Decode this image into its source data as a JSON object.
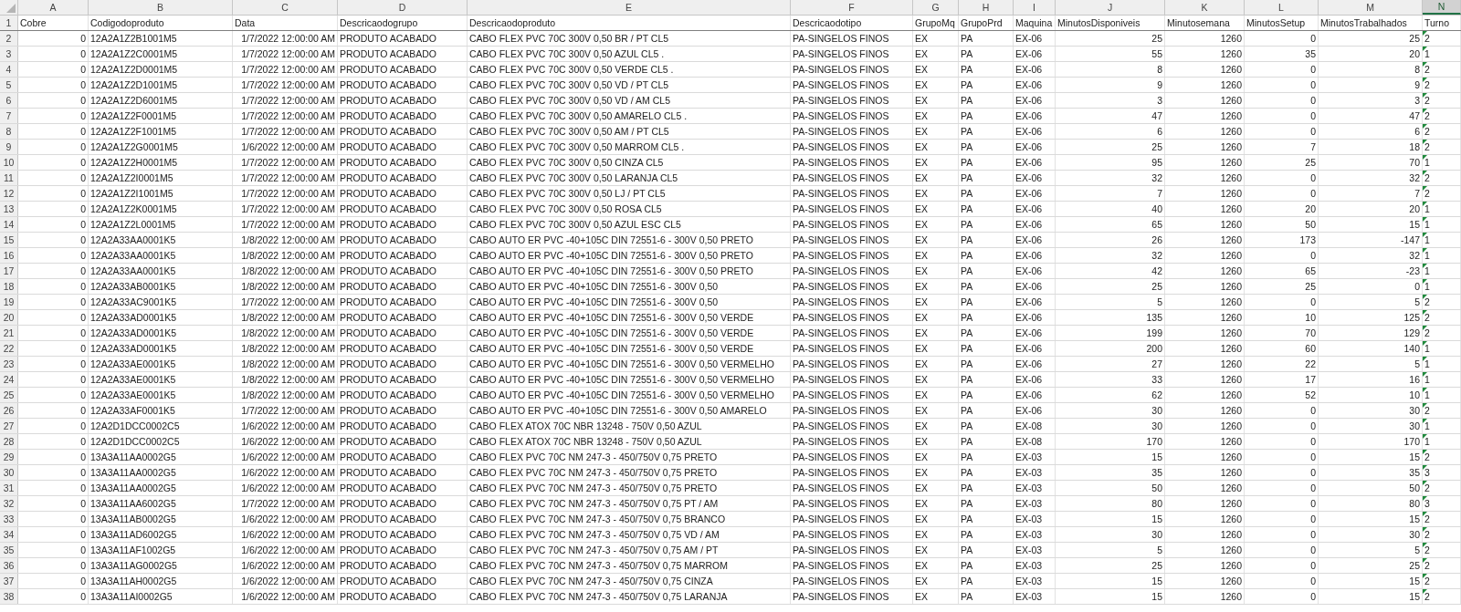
{
  "sheet": {
    "columns": [
      {
        "letter": "A",
        "kind": "number",
        "selected": false
      },
      {
        "letter": "B",
        "kind": "text",
        "selected": false
      },
      {
        "letter": "C",
        "kind": "number",
        "selected": false
      },
      {
        "letter": "D",
        "kind": "text",
        "selected": false
      },
      {
        "letter": "E",
        "kind": "text",
        "selected": false
      },
      {
        "letter": "F",
        "kind": "text",
        "selected": false
      },
      {
        "letter": "G",
        "kind": "text",
        "selected": false
      },
      {
        "letter": "H",
        "kind": "text",
        "selected": false
      },
      {
        "letter": "I",
        "kind": "text",
        "selected": false
      },
      {
        "letter": "J",
        "kind": "number",
        "selected": false
      },
      {
        "letter": "K",
        "kind": "number",
        "selected": false
      },
      {
        "letter": "L",
        "kind": "number",
        "selected": false
      },
      {
        "letter": "M",
        "kind": "number",
        "selected": false
      },
      {
        "letter": "N",
        "kind": "text",
        "selected": true
      }
    ],
    "rows": [
      {
        "number": "1",
        "kind": "header",
        "warning": false,
        "cells": [
          "Cobre",
          "Codigodoproduto",
          "Data",
          "Descricaodogrupo",
          "Descricaodoproduto",
          "Descricaodotipo",
          "GrupoMq",
          "GrupoPrd",
          "Maquina",
          "MinutosDisponiveis",
          "Minutosemana",
          "MinutosSetup",
          "MinutosTrabalhados",
          "Turno"
        ]
      },
      {
        "number": "2",
        "kind": "data",
        "warning": true,
        "cells": [
          "0",
          "12A2A1Z2B1001M5",
          "1/7/2022 12:00:00 AM",
          "PRODUTO ACABADO",
          "CABO FLEX PVC 70C 300V 0,50 BR / PT CL5",
          "PA-SINGELOS FINOS",
          "EX",
          "PA",
          "EX-06",
          "25",
          "1260",
          "0",
          "25",
          "2"
        ]
      },
      {
        "number": "3",
        "kind": "data",
        "warning": true,
        "cells": [
          "0",
          "12A2A1Z2C0001M5",
          "1/7/2022 12:00:00 AM",
          "PRODUTO ACABADO",
          "CABO FLEX PVC 70C 300V 0,50 AZUL CL5 .",
          "PA-SINGELOS FINOS",
          "EX",
          "PA",
          "EX-06",
          "55",
          "1260",
          "35",
          "20",
          "1"
        ]
      },
      {
        "number": "4",
        "kind": "data",
        "warning": true,
        "cells": [
          "0",
          "12A2A1Z2D0001M5",
          "1/7/2022 12:00:00 AM",
          "PRODUTO ACABADO",
          "CABO FLEX PVC 70C 300V 0,50 VERDE CL5 .",
          "PA-SINGELOS FINOS",
          "EX",
          "PA",
          "EX-06",
          "8",
          "1260",
          "0",
          "8",
          "2"
        ]
      },
      {
        "number": "5",
        "kind": "data",
        "warning": true,
        "cells": [
          "0",
          "12A2A1Z2D1001M5",
          "1/7/2022 12:00:00 AM",
          "PRODUTO ACABADO",
          "CABO FLEX PVC 70C 300V 0,50 VD / PT CL5",
          "PA-SINGELOS FINOS",
          "EX",
          "PA",
          "EX-06",
          "9",
          "1260",
          "0",
          "9",
          "2"
        ]
      },
      {
        "number": "6",
        "kind": "data",
        "warning": true,
        "cells": [
          "0",
          "12A2A1Z2D6001M5",
          "1/7/2022 12:00:00 AM",
          "PRODUTO ACABADO",
          "CABO FLEX PVC 70C 300V 0,50 VD / AM CL5",
          "PA-SINGELOS FINOS",
          "EX",
          "PA",
          "EX-06",
          "3",
          "1260",
          "0",
          "3",
          "2"
        ]
      },
      {
        "number": "7",
        "kind": "data",
        "warning": true,
        "cells": [
          "0",
          "12A2A1Z2F0001M5",
          "1/7/2022 12:00:00 AM",
          "PRODUTO ACABADO",
          "CABO FLEX PVC 70C 300V 0,50 AMARELO CL5 .",
          "PA-SINGELOS FINOS",
          "EX",
          "PA",
          "EX-06",
          "47",
          "1260",
          "0",
          "47",
          "2"
        ]
      },
      {
        "number": "8",
        "kind": "data",
        "warning": true,
        "cells": [
          "0",
          "12A2A1Z2F1001M5",
          "1/7/2022 12:00:00 AM",
          "PRODUTO ACABADO",
          "CABO FLEX PVC 70C 300V 0,50 AM / PT CL5",
          "PA-SINGELOS FINOS",
          "EX",
          "PA",
          "EX-06",
          "6",
          "1260",
          "0",
          "6",
          "2"
        ]
      },
      {
        "number": "9",
        "kind": "data",
        "warning": true,
        "cells": [
          "0",
          "12A2A1Z2G0001M5",
          "1/6/2022 12:00:00 AM",
          "PRODUTO ACABADO",
          "CABO FLEX PVC 70C 300V 0,50 MARROM CL5 .",
          "PA-SINGELOS FINOS",
          "EX",
          "PA",
          "EX-06",
          "25",
          "1260",
          "7",
          "18",
          "2"
        ]
      },
      {
        "number": "10",
        "kind": "data",
        "warning": true,
        "cells": [
          "0",
          "12A2A1Z2H0001M5",
          "1/7/2022 12:00:00 AM",
          "PRODUTO ACABADO",
          "CABO FLEX PVC 70C 300V 0,50 CINZA CL5",
          "PA-SINGELOS FINOS",
          "EX",
          "PA",
          "EX-06",
          "95",
          "1260",
          "25",
          "70",
          "1"
        ]
      },
      {
        "number": "11",
        "kind": "data",
        "warning": true,
        "cells": [
          "0",
          "12A2A1Z2I0001M5",
          "1/7/2022 12:00:00 AM",
          "PRODUTO ACABADO",
          "CABO FLEX PVC 70C 300V 0,50 LARANJA CL5",
          "PA-SINGELOS FINOS",
          "EX",
          "PA",
          "EX-06",
          "32",
          "1260",
          "0",
          "32",
          "2"
        ]
      },
      {
        "number": "12",
        "kind": "data",
        "warning": true,
        "cells": [
          "0",
          "12A2A1Z2I1001M5",
          "1/7/2022 12:00:00 AM",
          "PRODUTO ACABADO",
          "CABO FLEX PVC 70C 300V 0,50 LJ / PT CL5",
          "PA-SINGELOS FINOS",
          "EX",
          "PA",
          "EX-06",
          "7",
          "1260",
          "0",
          "7",
          "2"
        ]
      },
      {
        "number": "13",
        "kind": "data",
        "warning": true,
        "cells": [
          "0",
          "12A2A1Z2K0001M5",
          "1/7/2022 12:00:00 AM",
          "PRODUTO ACABADO",
          "CABO FLEX PVC 70C 300V 0,50 ROSA CL5",
          "PA-SINGELOS FINOS",
          "EX",
          "PA",
          "EX-06",
          "40",
          "1260",
          "20",
          "20",
          "1"
        ]
      },
      {
        "number": "14",
        "kind": "data",
        "warning": true,
        "cells": [
          "0",
          "12A2A1Z2L0001M5",
          "1/7/2022 12:00:00 AM",
          "PRODUTO ACABADO",
          "CABO FLEX PVC 70C 300V 0,50 AZUL ESC CL5",
          "PA-SINGELOS FINOS",
          "EX",
          "PA",
          "EX-06",
          "65",
          "1260",
          "50",
          "15",
          "1"
        ]
      },
      {
        "number": "15",
        "kind": "data",
        "warning": true,
        "cells": [
          "0",
          "12A2A33AA0001K5",
          "1/8/2022 12:00:00 AM",
          "PRODUTO ACABADO",
          "CABO AUTO ER PVC -40+105C DIN 72551-6 - 300V 0,50 PRETO",
          "PA-SINGELOS FINOS",
          "EX",
          "PA",
          "EX-06",
          "26",
          "1260",
          "173",
          "-147",
          "1"
        ]
      },
      {
        "number": "16",
        "kind": "data",
        "warning": true,
        "cells": [
          "0",
          "12A2A33AA0001K5",
          "1/8/2022 12:00:00 AM",
          "PRODUTO ACABADO",
          "CABO AUTO ER PVC -40+105C DIN 72551-6 - 300V 0,50 PRETO",
          "PA-SINGELOS FINOS",
          "EX",
          "PA",
          "EX-06",
          "32",
          "1260",
          "0",
          "32",
          "1"
        ]
      },
      {
        "number": "17",
        "kind": "data",
        "warning": true,
        "cells": [
          "0",
          "12A2A33AA0001K5",
          "1/8/2022 12:00:00 AM",
          "PRODUTO ACABADO",
          "CABO AUTO ER PVC -40+105C DIN 72551-6 - 300V 0,50 PRETO",
          "PA-SINGELOS FINOS",
          "EX",
          "PA",
          "EX-06",
          "42",
          "1260",
          "65",
          "-23",
          "1"
        ]
      },
      {
        "number": "18",
        "kind": "data",
        "warning": true,
        "cells": [
          "0",
          "12A2A33AB0001K5",
          "1/8/2022 12:00:00 AM",
          "PRODUTO ACABADO",
          "CABO AUTO ER PVC -40+105C DIN 72551-6 - 300V 0,50",
          "PA-SINGELOS FINOS",
          "EX",
          "PA",
          "EX-06",
          "25",
          "1260",
          "25",
          "0",
          "1"
        ]
      },
      {
        "number": "19",
        "kind": "data",
        "warning": true,
        "cells": [
          "0",
          "12A2A33AC9001K5",
          "1/7/2022 12:00:00 AM",
          "PRODUTO ACABADO",
          "CABO AUTO ER PVC -40+105C DIN 72551-6 - 300V 0,50",
          "PA-SINGELOS FINOS",
          "EX",
          "PA",
          "EX-06",
          "5",
          "1260",
          "0",
          "5",
          "2"
        ]
      },
      {
        "number": "20",
        "kind": "data",
        "warning": true,
        "cells": [
          "0",
          "12A2A33AD0001K5",
          "1/8/2022 12:00:00 AM",
          "PRODUTO ACABADO",
          "CABO AUTO ER PVC -40+105C DIN 72551-6 - 300V 0,50 VERDE",
          "PA-SINGELOS FINOS",
          "EX",
          "PA",
          "EX-06",
          "135",
          "1260",
          "10",
          "125",
          "2"
        ]
      },
      {
        "number": "21",
        "kind": "data",
        "warning": true,
        "cells": [
          "0",
          "12A2A33AD0001K5",
          "1/8/2022 12:00:00 AM",
          "PRODUTO ACABADO",
          "CABO AUTO ER PVC -40+105C DIN 72551-6 - 300V 0,50 VERDE",
          "PA-SINGELOS FINOS",
          "EX",
          "PA",
          "EX-06",
          "199",
          "1260",
          "70",
          "129",
          "2"
        ]
      },
      {
        "number": "22",
        "kind": "data",
        "warning": true,
        "cells": [
          "0",
          "12A2A33AD0001K5",
          "1/8/2022 12:00:00 AM",
          "PRODUTO ACABADO",
          "CABO AUTO ER PVC -40+105C DIN 72551-6 - 300V 0,50 VERDE",
          "PA-SINGELOS FINOS",
          "EX",
          "PA",
          "EX-06",
          "200",
          "1260",
          "60",
          "140",
          "1"
        ]
      },
      {
        "number": "23",
        "kind": "data",
        "warning": true,
        "cells": [
          "0",
          "12A2A33AE0001K5",
          "1/8/2022 12:00:00 AM",
          "PRODUTO ACABADO",
          "CABO AUTO ER PVC -40+105C DIN 72551-6 - 300V 0,50 VERMELHO",
          "PA-SINGELOS FINOS",
          "EX",
          "PA",
          "EX-06",
          "27",
          "1260",
          "22",
          "5",
          "1"
        ]
      },
      {
        "number": "24",
        "kind": "data",
        "warning": true,
        "cells": [
          "0",
          "12A2A33AE0001K5",
          "1/8/2022 12:00:00 AM",
          "PRODUTO ACABADO",
          "CABO AUTO ER PVC -40+105C DIN 72551-6 - 300V 0,50 VERMELHO",
          "PA-SINGELOS FINOS",
          "EX",
          "PA",
          "EX-06",
          "33",
          "1260",
          "17",
          "16",
          "1"
        ]
      },
      {
        "number": "25",
        "kind": "data",
        "warning": true,
        "cells": [
          "0",
          "12A2A33AE0001K5",
          "1/8/2022 12:00:00 AM",
          "PRODUTO ACABADO",
          "CABO AUTO ER PVC -40+105C DIN 72551-6 - 300V 0,50 VERMELHO",
          "PA-SINGELOS FINOS",
          "EX",
          "PA",
          "EX-06",
          "62",
          "1260",
          "52",
          "10",
          "1"
        ]
      },
      {
        "number": "26",
        "kind": "data",
        "warning": true,
        "cells": [
          "0",
          "12A2A33AF0001K5",
          "1/7/2022 12:00:00 AM",
          "PRODUTO ACABADO",
          "CABO AUTO ER PVC -40+105C DIN 72551-6 - 300V 0,50 AMARELO",
          "PA-SINGELOS FINOS",
          "EX",
          "PA",
          "EX-06",
          "30",
          "1260",
          "0",
          "30",
          "2"
        ]
      },
      {
        "number": "27",
        "kind": "data",
        "warning": true,
        "cells": [
          "0",
          "12A2D1DCC0002C5",
          "1/6/2022 12:00:00 AM",
          "PRODUTO ACABADO",
          "CABO FLEX ATOX 70C NBR 13248 - 750V 0,50 AZUL",
          "PA-SINGELOS FINOS",
          "EX",
          "PA",
          "EX-08",
          "30",
          "1260",
          "0",
          "30",
          "1"
        ]
      },
      {
        "number": "28",
        "kind": "data",
        "warning": true,
        "cells": [
          "0",
          "12A2D1DCC0002C5",
          "1/6/2022 12:00:00 AM",
          "PRODUTO ACABADO",
          "CABO FLEX ATOX 70C NBR 13248 - 750V 0,50 AZUL",
          "PA-SINGELOS FINOS",
          "EX",
          "PA",
          "EX-08",
          "170",
          "1260",
          "0",
          "170",
          "1"
        ]
      },
      {
        "number": "29",
        "kind": "data",
        "warning": true,
        "cells": [
          "0",
          "13A3A11AA0002G5",
          "1/6/2022 12:00:00 AM",
          "PRODUTO ACABADO",
          "CABO FLEX PVC 70C NM 247-3 - 450/750V 0,75 PRETO",
          "PA-SINGELOS FINOS",
          "EX",
          "PA",
          "EX-03",
          "15",
          "1260",
          "0",
          "15",
          "2"
        ]
      },
      {
        "number": "30",
        "kind": "data",
        "warning": true,
        "cells": [
          "0",
          "13A3A11AA0002G5",
          "1/6/2022 12:00:00 AM",
          "PRODUTO ACABADO",
          "CABO FLEX PVC 70C NM 247-3 - 450/750V 0,75 PRETO",
          "PA-SINGELOS FINOS",
          "EX",
          "PA",
          "EX-03",
          "35",
          "1260",
          "0",
          "35",
          "3"
        ]
      },
      {
        "number": "31",
        "kind": "data",
        "warning": true,
        "cells": [
          "0",
          "13A3A11AA0002G5",
          "1/6/2022 12:00:00 AM",
          "PRODUTO ACABADO",
          "CABO FLEX PVC 70C NM 247-3 - 450/750V 0,75 PRETO",
          "PA-SINGELOS FINOS",
          "EX",
          "PA",
          "EX-03",
          "50",
          "1260",
          "0",
          "50",
          "2"
        ]
      },
      {
        "number": "32",
        "kind": "data",
        "warning": true,
        "cells": [
          "0",
          "13A3A11AA6002G5",
          "1/7/2022 12:00:00 AM",
          "PRODUTO ACABADO",
          "CABO FLEX PVC 70C NM 247-3 - 450/750V 0,75 PT / AM",
          "PA-SINGELOS FINOS",
          "EX",
          "PA",
          "EX-03",
          "80",
          "1260",
          "0",
          "80",
          "3"
        ]
      },
      {
        "number": "33",
        "kind": "data",
        "warning": true,
        "cells": [
          "0",
          "13A3A11AB0002G5",
          "1/6/2022 12:00:00 AM",
          "PRODUTO ACABADO",
          "CABO FLEX PVC 70C NM 247-3 - 450/750V 0,75 BRANCO",
          "PA-SINGELOS FINOS",
          "EX",
          "PA",
          "EX-03",
          "15",
          "1260",
          "0",
          "15",
          "2"
        ]
      },
      {
        "number": "34",
        "kind": "data",
        "warning": true,
        "cells": [
          "0",
          "13A3A11AD6002G5",
          "1/6/2022 12:00:00 AM",
          "PRODUTO ACABADO",
          "CABO FLEX PVC 70C NM 247-3 - 450/750V 0,75 VD / AM",
          "PA-SINGELOS FINOS",
          "EX",
          "PA",
          "EX-03",
          "30",
          "1260",
          "0",
          "30",
          "2"
        ]
      },
      {
        "number": "35",
        "kind": "data",
        "warning": true,
        "cells": [
          "0",
          "13A3A11AF1002G5",
          "1/6/2022 12:00:00 AM",
          "PRODUTO ACABADO",
          "CABO FLEX PVC 70C NM 247-3 - 450/750V 0,75 AM / PT",
          "PA-SINGELOS FINOS",
          "EX",
          "PA",
          "EX-03",
          "5",
          "1260",
          "0",
          "5",
          "2"
        ]
      },
      {
        "number": "36",
        "kind": "data",
        "warning": true,
        "cells": [
          "0",
          "13A3A11AG0002G5",
          "1/6/2022 12:00:00 AM",
          "PRODUTO ACABADO",
          "CABO FLEX PVC 70C NM 247-3 - 450/750V 0,75 MARROM",
          "PA-SINGELOS FINOS",
          "EX",
          "PA",
          "EX-03",
          "25",
          "1260",
          "0",
          "25",
          "2"
        ]
      },
      {
        "number": "37",
        "kind": "data",
        "warning": true,
        "cells": [
          "0",
          "13A3A11AH0002G5",
          "1/6/2022 12:00:00 AM",
          "PRODUTO ACABADO",
          "CABO FLEX PVC 70C NM 247-3 - 450/750V 0,75 CINZA",
          "PA-SINGELOS FINOS",
          "EX",
          "PA",
          "EX-03",
          "15",
          "1260",
          "0",
          "15",
          "2"
        ]
      },
      {
        "number": "38",
        "kind": "data",
        "warning": true,
        "cells": [
          "0",
          "13A3A11AI0002G5",
          "1/6/2022 12:00:00 AM",
          "PRODUTO ACABADO",
          "CABO FLEX PVC 70C NM 247-3 - 450/750V 0,75 LARANJA",
          "PA-SINGELOS FINOS",
          "EX",
          "PA",
          "EX-03",
          "15",
          "1260",
          "0",
          "15",
          "2"
        ]
      }
    ]
  }
}
